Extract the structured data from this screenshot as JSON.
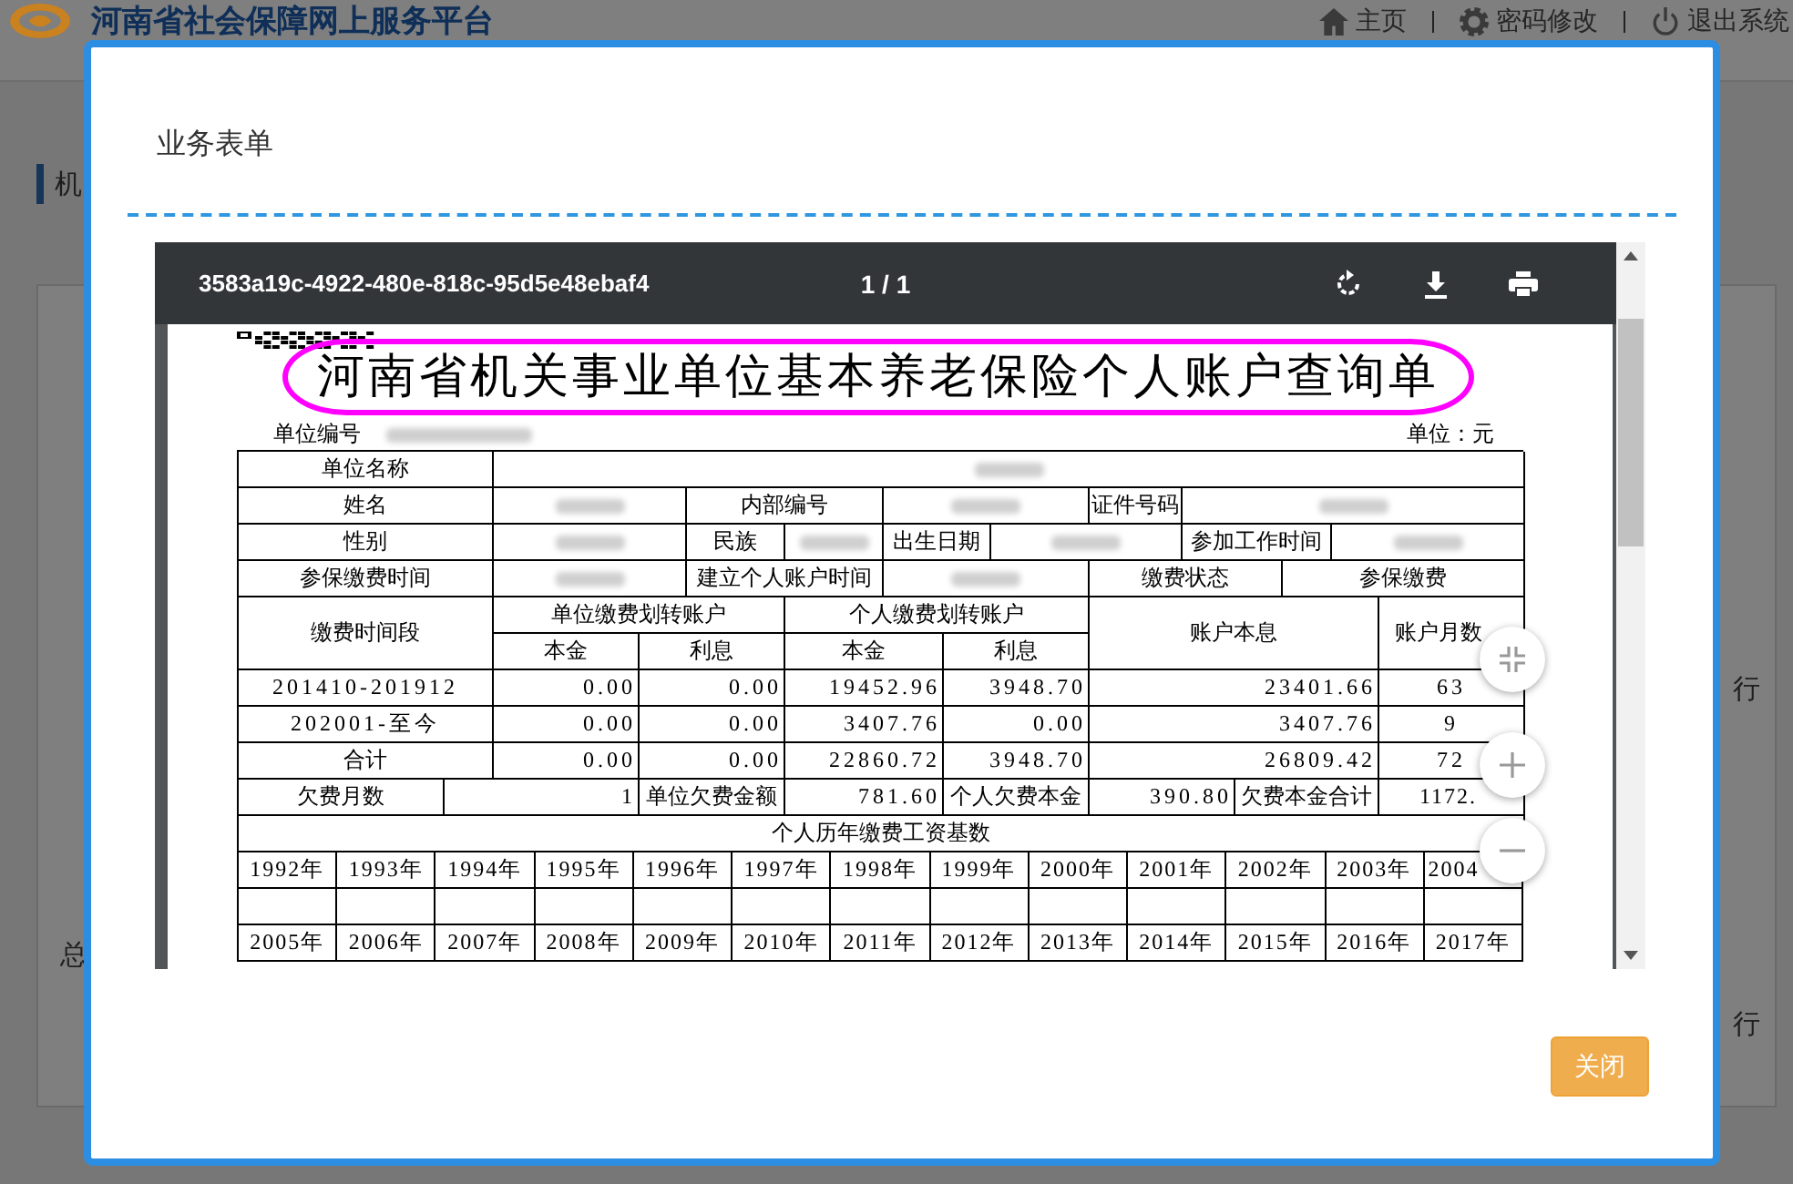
{
  "background": {
    "site_title": "河南省社会保障网上服务平台",
    "nav": [
      {
        "label": "主页"
      },
      {
        "label": "密码修改"
      },
      {
        "label": "退出系统"
      }
    ],
    "section_fragment": "机",
    "left_fragments": [
      "总"
    ],
    "right_fragments": [
      "行",
      "行"
    ]
  },
  "modal": {
    "title": "业务表单",
    "close_button": "关闭"
  },
  "viewer": {
    "file_name": "3583a19c-4922-480e-818c-95d5e48ebaf4",
    "page_indicator": "1 / 1"
  },
  "document": {
    "title": "河南省机关事业单位基本养老保险个人账户查询单",
    "unit_code_label": "单位编号",
    "unit_note": "单位：元",
    "rows": [
      {
        "kind": "r2",
        "cells": [
          {
            "kind": "label",
            "text": "单位名称"
          },
          {
            "kind": "redacted"
          }
        ]
      },
      {
        "kind": "r6",
        "cells": [
          {
            "kind": "label",
            "text": "姓名"
          },
          {
            "kind": "redacted"
          },
          {
            "kind": "label",
            "text": "内部编号"
          },
          {
            "kind": "redacted"
          },
          {
            "kind": "label",
            "text": "证件号码"
          },
          {
            "kind": "redacted"
          }
        ]
      },
      {
        "kind": "r8",
        "cells": [
          {
            "kind": "label",
            "text": "性别"
          },
          {
            "kind": "redacted"
          },
          {
            "kind": "label",
            "text": "民族"
          },
          {
            "kind": "redacted"
          },
          {
            "kind": "label",
            "text": "出生日期"
          },
          {
            "kind": "redacted"
          },
          {
            "kind": "label",
            "text": "参加工作时间"
          },
          {
            "kind": "redacted"
          }
        ]
      },
      {
        "kind": "r6b",
        "cells": [
          {
            "kind": "label",
            "text": "参保缴费时间"
          },
          {
            "kind": "redacted"
          },
          {
            "kind": "label",
            "text": "建立个人账户时间"
          },
          {
            "kind": "redacted"
          },
          {
            "kind": "label",
            "text": "缴费状态"
          },
          {
            "kind": "label",
            "text": "参保缴费"
          }
        ]
      }
    ],
    "header": [
      {
        "label": "缴费时间段"
      },
      {
        "label": "单位缴费划转账户",
        "sub": [
          "本金",
          "利息"
        ]
      },
      {
        "label": "个人缴费划转账户",
        "sub": [
          "本金",
          "利息"
        ]
      },
      {
        "label": "账户本息"
      },
      {
        "label": "账户月数"
      }
    ],
    "body": [
      {
        "kind": "r7",
        "cells": [
          {
            "kind": "text",
            "text": "201410-201912"
          },
          {
            "kind": "number",
            "text": "0.00"
          },
          {
            "kind": "number",
            "text": "0.00"
          },
          {
            "kind": "number",
            "text": "19452.96"
          },
          {
            "kind": "number",
            "text": "3948.70"
          },
          {
            "kind": "number",
            "text": "23401.66"
          },
          {
            "kind": "count",
            "text": "63"
          }
        ]
      },
      {
        "kind": "r7",
        "cells": [
          {
            "kind": "text",
            "text": "202001-至今"
          },
          {
            "kind": "number",
            "text": "0.00"
          },
          {
            "kind": "number",
            "text": "0.00"
          },
          {
            "kind": "number",
            "text": "3407.76"
          },
          {
            "kind": "number",
            "text": "0.00"
          },
          {
            "kind": "number",
            "text": "3407.76"
          },
          {
            "kind": "count",
            "text": "9"
          }
        ]
      },
      {
        "kind": "r7",
        "cells": [
          {
            "kind": "label",
            "text": "合计"
          },
          {
            "kind": "number",
            "text": "0.00"
          },
          {
            "kind": "number",
            "text": "0.00"
          },
          {
            "kind": "number",
            "text": "22860.72"
          },
          {
            "kind": "number",
            "text": "3948.70"
          },
          {
            "kind": "number",
            "text": "26809.42"
          },
          {
            "kind": "count",
            "text": "72"
          }
        ]
      },
      {
        "kind": "r8b",
        "cells": [
          {
            "kind": "label",
            "text": "欠费月数"
          },
          {
            "kind": "number",
            "text": "1"
          },
          {
            "kind": "label",
            "text": "单位欠费金额"
          },
          {
            "kind": "number",
            "text": "781.60"
          },
          {
            "kind": "label",
            "text": "个人欠费本金"
          },
          {
            "kind": "number",
            "text": "390.80"
          },
          {
            "kind": "label",
            "text": "欠费本金合计"
          },
          {
            "kind": "number_cut",
            "text": "1172."
          }
        ]
      },
      {
        "kind": "r1",
        "cells": [
          {
            "kind": "label",
            "text": "个人历年缴费工资基数"
          }
        ]
      },
      {
        "kind": "years",
        "cells": [
          {
            "kind": "year",
            "text": "1992年"
          },
          {
            "kind": "year",
            "text": "1993年"
          },
          {
            "kind": "year",
            "text": "1994年"
          },
          {
            "kind": "year",
            "text": "1995年"
          },
          {
            "kind": "year",
            "text": "1996年"
          },
          {
            "kind": "year",
            "text": "1997年"
          },
          {
            "kind": "year",
            "text": "1998年"
          },
          {
            "kind": "year",
            "text": "1999年"
          },
          {
            "kind": "year",
            "text": "2000年"
          },
          {
            "kind": "year",
            "text": "2001年"
          },
          {
            "kind": "year",
            "text": "2002年"
          },
          {
            "kind": "year",
            "text": "2003年"
          },
          {
            "kind": "lead",
            "text": "2004"
          }
        ]
      },
      {
        "kind": "empty"
      },
      {
        "kind": "years",
        "cells": [
          {
            "kind": "year",
            "text": "2005年"
          },
          {
            "kind": "year",
            "text": "2006年"
          },
          {
            "kind": "year",
            "text": "2007年"
          },
          {
            "kind": "year",
            "text": "2008年"
          },
          {
            "kind": "year",
            "text": "2009年"
          },
          {
            "kind": "year",
            "text": "2010年"
          },
          {
            "kind": "year",
            "text": "2011年"
          },
          {
            "kind": "year",
            "text": "2012年"
          },
          {
            "kind": "year",
            "text": "2013年"
          },
          {
            "kind": "year",
            "text": "2014年"
          },
          {
            "kind": "year",
            "text": "2015年"
          },
          {
            "kind": "year",
            "text": "2016年"
          },
          {
            "kind": "year",
            "text": "2017年"
          }
        ]
      }
    ]
  }
}
